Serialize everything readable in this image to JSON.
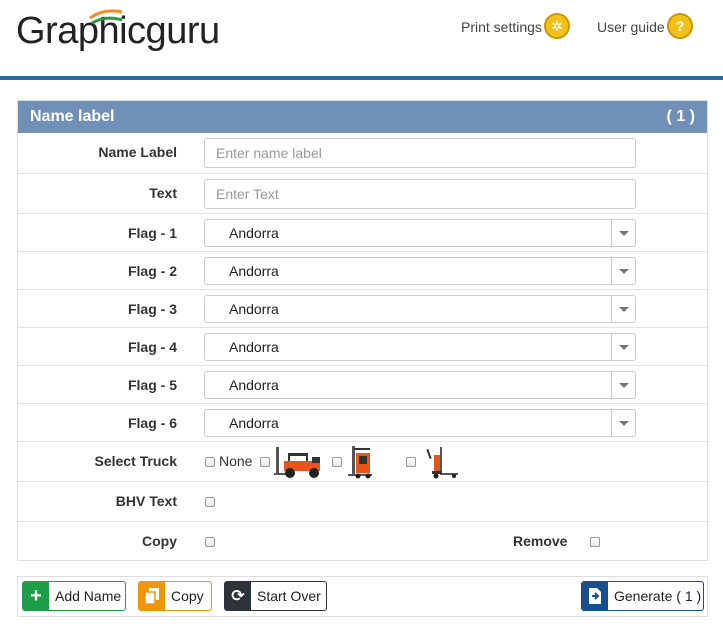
{
  "header": {
    "logo_text": "Graphicguru",
    "print_settings_label": "Print settings",
    "print_settings_icon": "gear-icon",
    "user_guide_label": "User guide",
    "user_guide_icon": "question-icon",
    "accent_color": "#2a6aa0"
  },
  "panel": {
    "title": "Name label",
    "count": "( 1 )",
    "header_color": "#7190b7"
  },
  "form": {
    "name_label": {
      "label": "Name Label",
      "placeholder": "Enter name label",
      "value": ""
    },
    "text": {
      "label": "Text",
      "placeholder": "Enter Text",
      "value": ""
    },
    "flags": [
      {
        "label": "Flag - 1",
        "value": "Andorra"
      },
      {
        "label": "Flag - 2",
        "value": "Andorra"
      },
      {
        "label": "Flag - 3",
        "value": "Andorra"
      },
      {
        "label": "Flag - 4",
        "value": "Andorra"
      },
      {
        "label": "Flag - 5",
        "value": "Andorra"
      },
      {
        "label": "Flag - 6",
        "value": "Andorra"
      }
    ],
    "select_truck": {
      "label": "Select Truck",
      "options": [
        {
          "label": "None",
          "checked": false
        },
        {
          "label": "",
          "icon": "counterbalance-forklift-icon",
          "checked": false
        },
        {
          "label": "",
          "icon": "reach-truck-icon",
          "checked": false
        },
        {
          "label": "",
          "icon": "pallet-stacker-icon",
          "checked": false
        }
      ]
    },
    "bhv_text": {
      "label": "BHV Text",
      "checked": false
    },
    "copy": {
      "label": "Copy",
      "checked": false
    },
    "remove": {
      "label": "Remove",
      "checked": false
    }
  },
  "toolbar": {
    "add_name_label": "Add Name",
    "copy_label": "Copy",
    "start_over_label": "Start Over",
    "generate_label": "Generate ( 1 )",
    "colors": {
      "add": "#1e9e48",
      "copy": "#f0960c",
      "start_over": "#2d3338",
      "generate": "#17508f"
    }
  }
}
